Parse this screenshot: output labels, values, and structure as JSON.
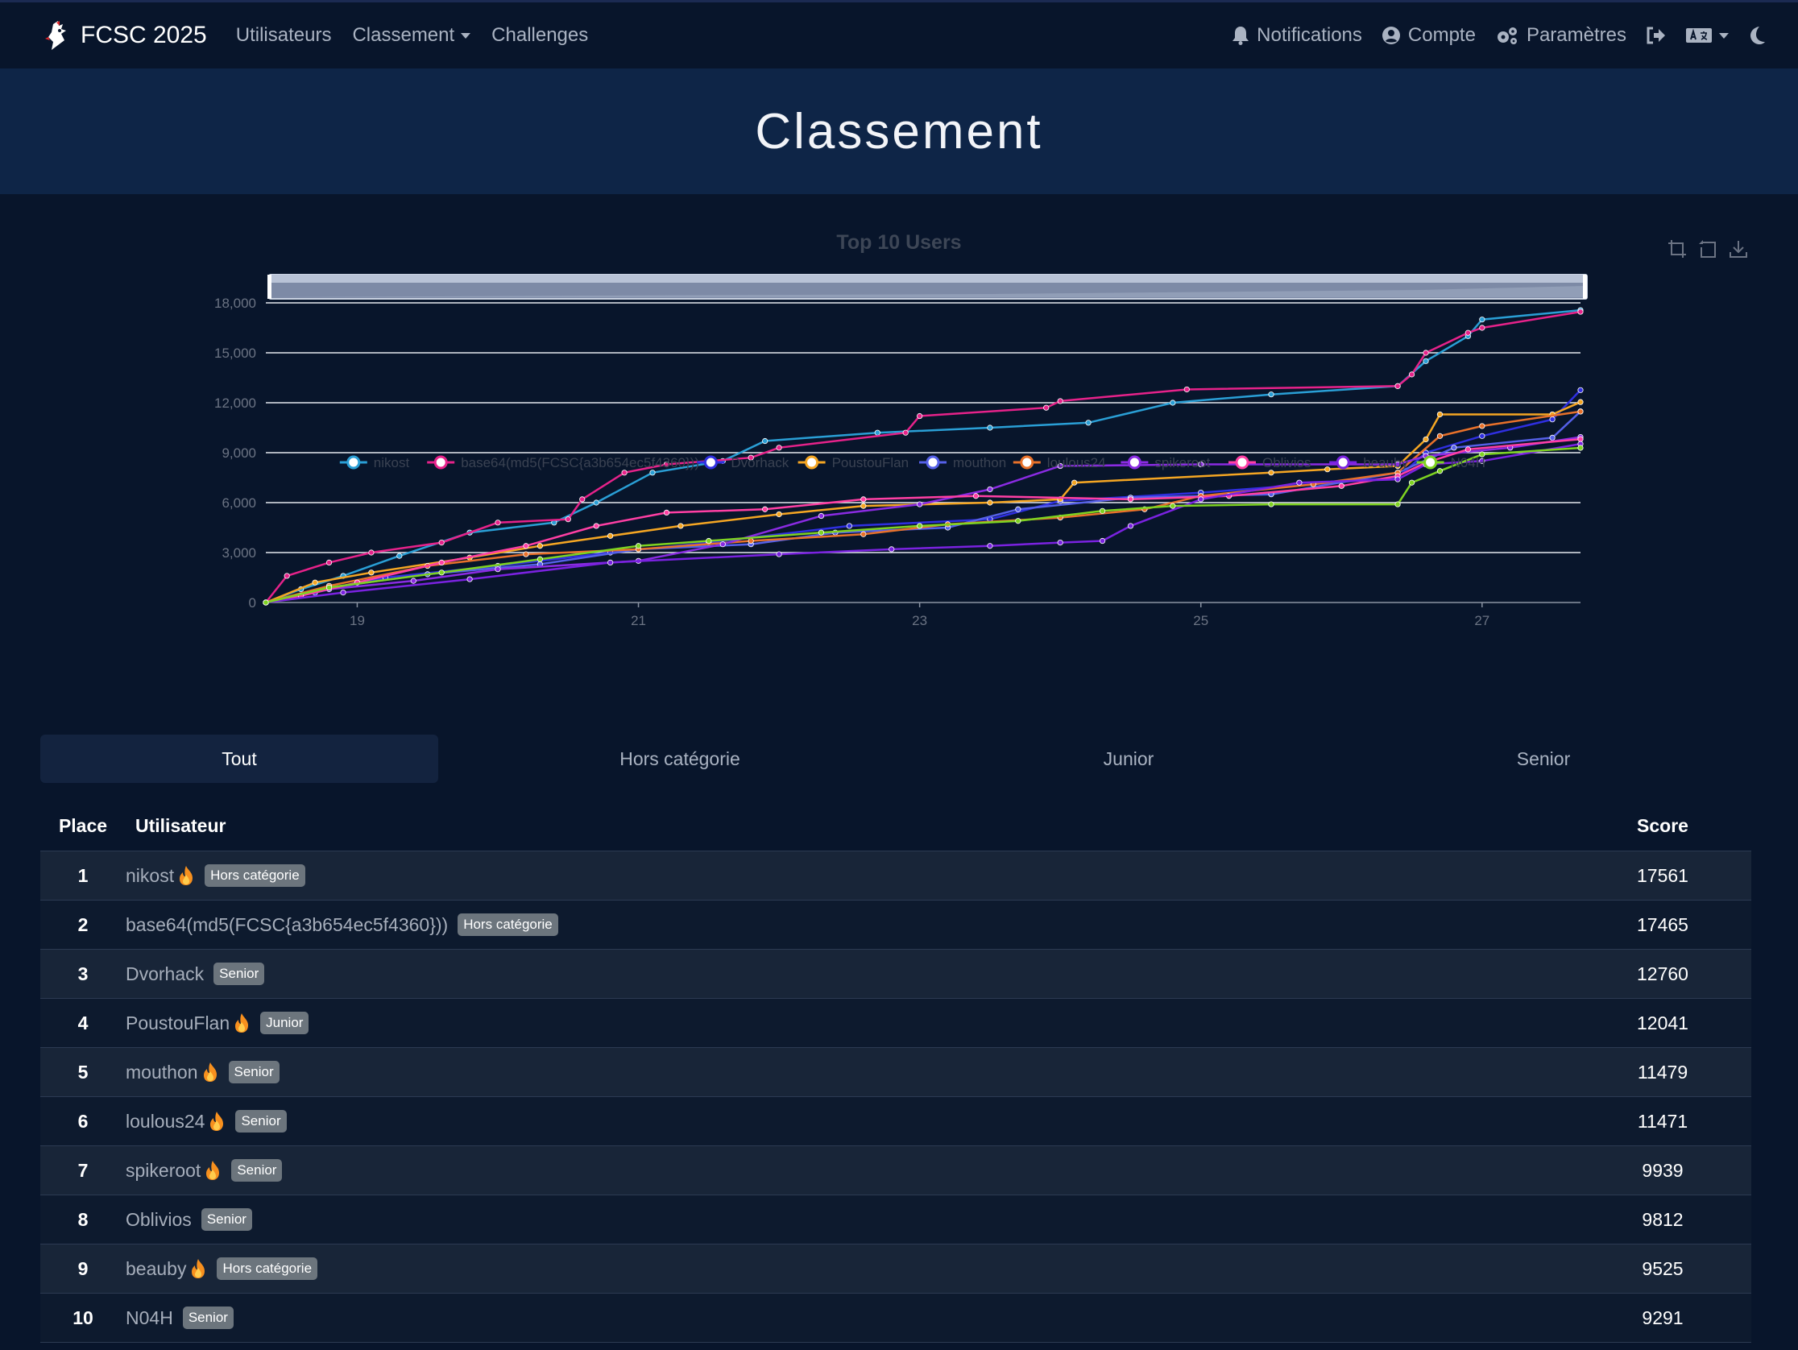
{
  "navbar": {
    "brand": "FCSC 2025",
    "links": [
      {
        "label": "Utilisateurs"
      },
      {
        "label": "Classement"
      },
      {
        "label": "Challenges"
      }
    ],
    "right": {
      "notifications": "Notifications",
      "account": "Compte",
      "settings": "Paramètres"
    }
  },
  "hero": {
    "title": "Classement"
  },
  "chart_data": {
    "type": "line",
    "title": "Top 10 Users",
    "xlabel": "",
    "ylabel": "",
    "x_ticks": [
      "19",
      "21",
      "23",
      "25",
      "27"
    ],
    "y_ticks": [
      "0",
      "3,000",
      "6,000",
      "9,000",
      "12,000",
      "15,000",
      "18,000"
    ],
    "xlim": [
      18.35,
      27.7
    ],
    "ylim": [
      0,
      18000
    ],
    "grid": true,
    "legend_position": "bottom",
    "series": [
      {
        "name": "nikost",
        "color": "#2a9fd6",
        "points": [
          [
            18.35,
            0
          ],
          [
            18.6,
            800
          ],
          [
            18.9,
            1600
          ],
          [
            19.3,
            2800
          ],
          [
            19.8,
            4200
          ],
          [
            20.4,
            4800
          ],
          [
            20.7,
            6000
          ],
          [
            21.1,
            7800
          ],
          [
            21.6,
            8500
          ],
          [
            21.9,
            9700
          ],
          [
            22.7,
            10200
          ],
          [
            23.5,
            10500
          ],
          [
            24.2,
            10800
          ],
          [
            24.8,
            12000
          ],
          [
            25.5,
            12500
          ],
          [
            26.4,
            13000
          ],
          [
            26.6,
            14500
          ],
          [
            26.9,
            16000
          ],
          [
            27.0,
            17000
          ],
          [
            27.7,
            17561
          ]
        ]
      },
      {
        "name": "base64(md5(FCSC{a3b654ec5f4360}))",
        "color": "#e6228a",
        "points": [
          [
            18.35,
            0
          ],
          [
            18.5,
            1600
          ],
          [
            18.8,
            2400
          ],
          [
            19.1,
            3000
          ],
          [
            19.6,
            3600
          ],
          [
            20.0,
            4800
          ],
          [
            20.5,
            5000
          ],
          [
            20.6,
            6200
          ],
          [
            20.9,
            7800
          ],
          [
            21.2,
            8300
          ],
          [
            21.8,
            8700
          ],
          [
            22.0,
            9300
          ],
          [
            22.9,
            10200
          ],
          [
            23.0,
            11200
          ],
          [
            23.9,
            11700
          ],
          [
            24.0,
            12100
          ],
          [
            24.9,
            12800
          ],
          [
            26.4,
            13000
          ],
          [
            26.5,
            13700
          ],
          [
            26.6,
            15000
          ],
          [
            26.9,
            16200
          ],
          [
            27.0,
            16500
          ],
          [
            27.7,
            17465
          ]
        ]
      },
      {
        "name": "Dvorhack",
        "color": "#2f2fe0",
        "points": [
          [
            18.35,
            0
          ],
          [
            18.7,
            600
          ],
          [
            19.2,
            1500
          ],
          [
            20.0,
            2200
          ],
          [
            20.8,
            3000
          ],
          [
            21.5,
            3600
          ],
          [
            22.5,
            4600
          ],
          [
            23.5,
            5000
          ],
          [
            24.0,
            6100
          ],
          [
            25.0,
            6600
          ],
          [
            26.4,
            7500
          ],
          [
            26.6,
            9000
          ],
          [
            27.0,
            10000
          ],
          [
            27.5,
            11000
          ],
          [
            27.7,
            12760
          ]
        ]
      },
      {
        "name": "PoustouFlan",
        "color": "#f5a623",
        "points": [
          [
            18.35,
            0
          ],
          [
            18.7,
            1200
          ],
          [
            19.1,
            1800
          ],
          [
            19.8,
            2700
          ],
          [
            20.3,
            3400
          ],
          [
            20.8,
            4000
          ],
          [
            21.3,
            4600
          ],
          [
            22.0,
            5300
          ],
          [
            22.6,
            5800
          ],
          [
            23.5,
            6000
          ],
          [
            24.0,
            6200
          ],
          [
            24.1,
            7200
          ],
          [
            25.5,
            7800
          ],
          [
            25.9,
            8000
          ],
          [
            26.4,
            8200
          ],
          [
            26.6,
            9800
          ],
          [
            26.7,
            11300
          ],
          [
            27.5,
            11300
          ],
          [
            27.7,
            12041
          ]
        ]
      },
      {
        "name": "mouthon",
        "color": "#5560e8",
        "points": [
          [
            18.35,
            0
          ],
          [
            18.8,
            900
          ],
          [
            19.5,
            1700
          ],
          [
            20.3,
            2300
          ],
          [
            21.0,
            3200
          ],
          [
            21.8,
            3500
          ],
          [
            22.4,
            4200
          ],
          [
            23.2,
            4500
          ],
          [
            23.7,
            5600
          ],
          [
            24.5,
            6300
          ],
          [
            25.5,
            6500
          ],
          [
            26.4,
            7800
          ],
          [
            26.8,
            9300
          ],
          [
            27.5,
            9900
          ],
          [
            27.7,
            11479
          ]
        ]
      },
      {
        "name": "loulous24",
        "color": "#e8712a",
        "points": [
          [
            18.35,
            0
          ],
          [
            18.8,
            1000
          ],
          [
            19.5,
            2200
          ],
          [
            20.2,
            2900
          ],
          [
            21.0,
            3200
          ],
          [
            21.8,
            3700
          ],
          [
            22.6,
            4100
          ],
          [
            23.2,
            4700
          ],
          [
            24.0,
            5100
          ],
          [
            24.6,
            5600
          ],
          [
            25.0,
            6400
          ],
          [
            25.8,
            7100
          ],
          [
            26.4,
            7800
          ],
          [
            26.7,
            10000
          ],
          [
            27.0,
            10600
          ],
          [
            27.7,
            11471
          ]
        ]
      },
      {
        "name": "spikeroot",
        "color": "#8a2be2",
        "points": [
          [
            18.35,
            0
          ],
          [
            18.8,
            800
          ],
          [
            19.4,
            1300
          ],
          [
            20.0,
            2000
          ],
          [
            21.0,
            2500
          ],
          [
            21.6,
            3500
          ],
          [
            22.3,
            5200
          ],
          [
            23.0,
            5900
          ],
          [
            23.5,
            6800
          ],
          [
            24.0,
            8200
          ],
          [
            25.0,
            8300
          ],
          [
            26.4,
            8300
          ],
          [
            26.6,
            8800
          ],
          [
            27.2,
            9300
          ],
          [
            27.7,
            9939
          ]
        ]
      },
      {
        "name": "Oblivios",
        "color": "#ff3fa4",
        "points": [
          [
            18.35,
            0
          ],
          [
            18.6,
            400
          ],
          [
            19.0,
            1200
          ],
          [
            19.6,
            2400
          ],
          [
            20.2,
            3400
          ],
          [
            20.7,
            4600
          ],
          [
            21.2,
            5400
          ],
          [
            21.9,
            5600
          ],
          [
            22.6,
            6200
          ],
          [
            23.4,
            6400
          ],
          [
            24.5,
            6200
          ],
          [
            25.2,
            6400
          ],
          [
            26.0,
            7000
          ],
          [
            26.4,
            7600
          ],
          [
            26.6,
            8400
          ],
          [
            26.9,
            9200
          ],
          [
            27.7,
            9812
          ]
        ]
      },
      {
        "name": "beauby",
        "color": "#7a22e0",
        "points": [
          [
            18.35,
            0
          ],
          [
            18.9,
            600
          ],
          [
            19.8,
            1400
          ],
          [
            20.8,
            2400
          ],
          [
            22.0,
            2900
          ],
          [
            22.8,
            3200
          ],
          [
            23.5,
            3400
          ],
          [
            24.0,
            3600
          ],
          [
            24.3,
            3700
          ],
          [
            24.5,
            4600
          ],
          [
            25.0,
            6200
          ],
          [
            25.7,
            7200
          ],
          [
            26.4,
            7400
          ],
          [
            26.6,
            8300
          ],
          [
            27.0,
            8500
          ],
          [
            27.7,
            9525
          ]
        ]
      },
      {
        "name": "N04H",
        "color": "#7ed321",
        "points": [
          [
            18.35,
            0
          ],
          [
            18.8,
            900
          ],
          [
            19.6,
            1800
          ],
          [
            20.3,
            2600
          ],
          [
            21.0,
            3400
          ],
          [
            21.5,
            3700
          ],
          [
            22.3,
            4200
          ],
          [
            23.0,
            4600
          ],
          [
            23.7,
            4900
          ],
          [
            24.3,
            5500
          ],
          [
            24.8,
            5800
          ],
          [
            25.5,
            5900
          ],
          [
            26.4,
            5900
          ],
          [
            26.5,
            7200
          ],
          [
            26.7,
            7900
          ],
          [
            27.0,
            8900
          ],
          [
            27.7,
            9291
          ]
        ]
      }
    ]
  },
  "tabs": [
    {
      "label": "Tout",
      "active": true
    },
    {
      "label": "Hors catégorie"
    },
    {
      "label": "Junior"
    },
    {
      "label": "Senior"
    }
  ],
  "table": {
    "headers": {
      "place": "Place",
      "user": "Utilisateur",
      "score": "Score"
    },
    "rows": [
      {
        "place": "1",
        "user": "nikost",
        "flame": true,
        "badge": "Hors catégorie",
        "score": "17561"
      },
      {
        "place": "2",
        "user": "base64(md5(FCSC{a3b654ec5f4360}))",
        "flame": false,
        "badge": "Hors catégorie",
        "score": "17465"
      },
      {
        "place": "3",
        "user": "Dvorhack",
        "flame": false,
        "badge": "Senior",
        "score": "12760"
      },
      {
        "place": "4",
        "user": "PoustouFlan",
        "flame": true,
        "badge": "Junior",
        "score": "12041"
      },
      {
        "place": "5",
        "user": "mouthon",
        "flame": true,
        "badge": "Senior",
        "score": "11479"
      },
      {
        "place": "6",
        "user": "loulous24",
        "flame": true,
        "badge": "Senior",
        "score": "11471"
      },
      {
        "place": "7",
        "user": "spikeroot",
        "flame": true,
        "badge": "Senior",
        "score": "9939"
      },
      {
        "place": "8",
        "user": "Oblivios",
        "flame": false,
        "badge": "Senior",
        "score": "9812"
      },
      {
        "place": "9",
        "user": "beauby",
        "flame": true,
        "badge": "Hors catégorie",
        "score": "9525"
      },
      {
        "place": "10",
        "user": "N04H",
        "flame": false,
        "badge": "Senior",
        "score": "9291"
      }
    ]
  }
}
